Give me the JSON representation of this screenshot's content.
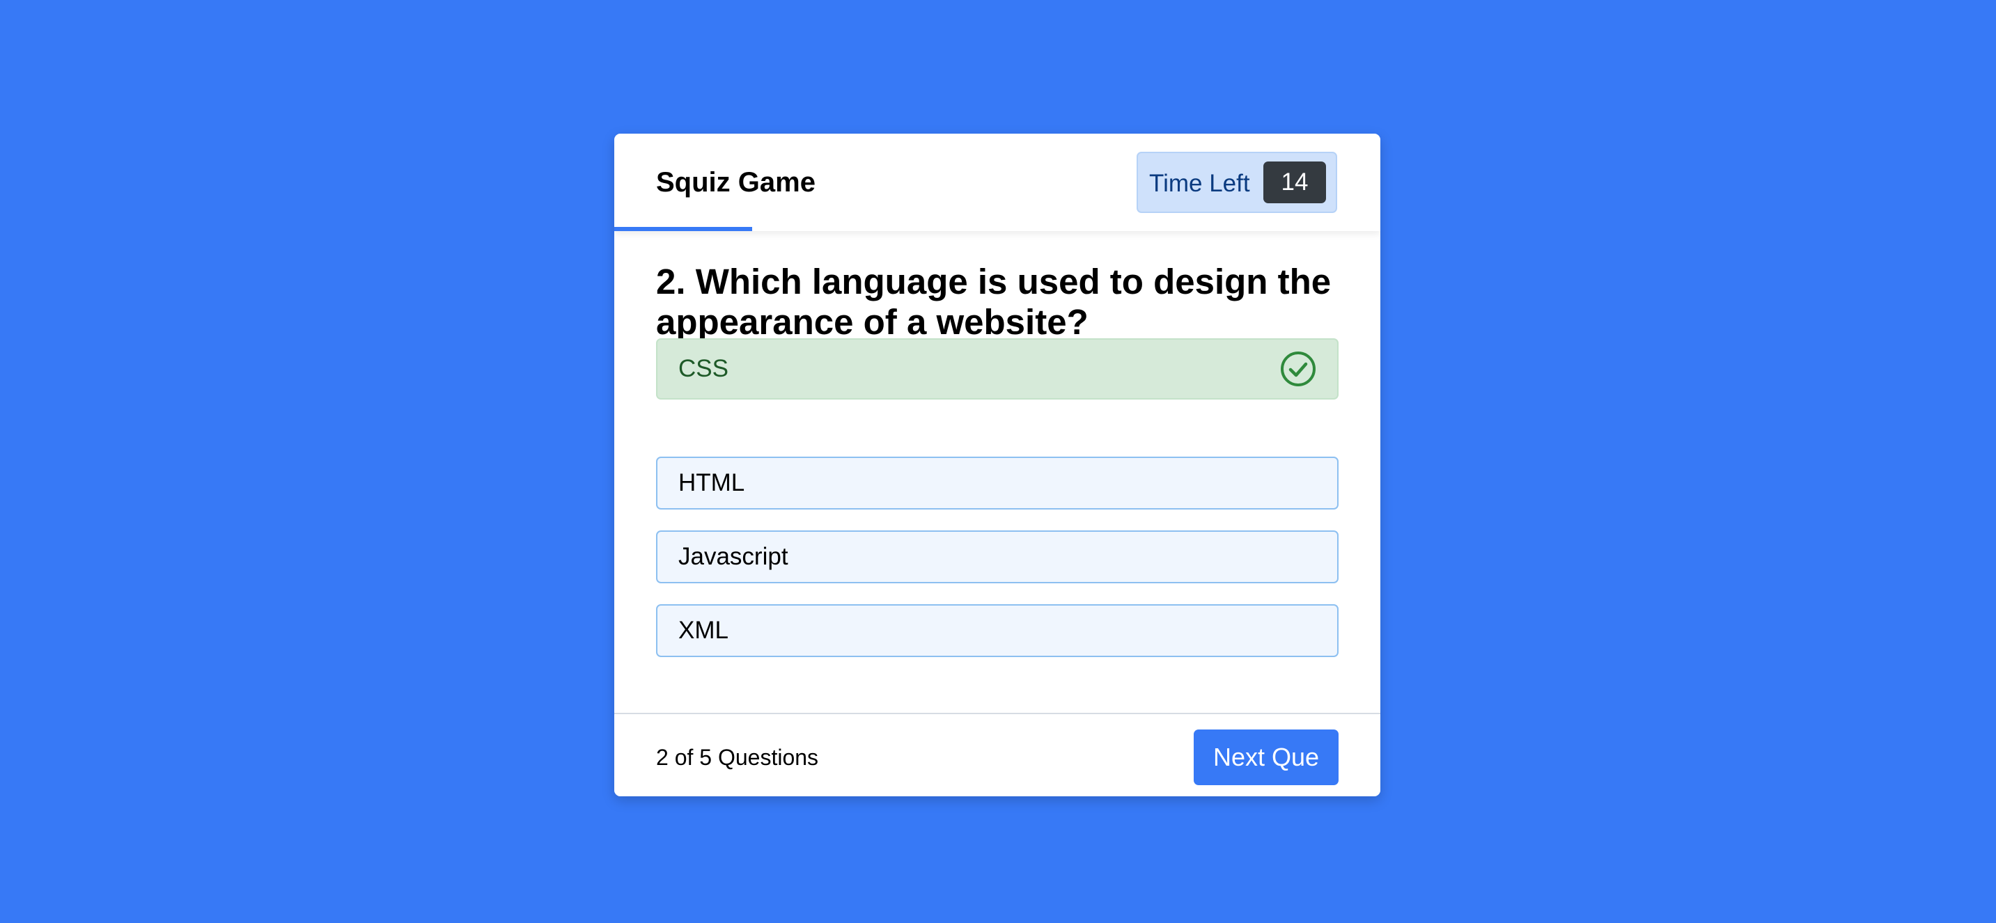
{
  "header": {
    "title": "Squiz Game",
    "timer_label": "Time Left",
    "timer_value": "14",
    "time_progress": 0.18
  },
  "question": {
    "text": "2. Which language is used to design the appearance of a website?"
  },
  "options": [
    {
      "label": "CSS",
      "state": "correct",
      "icon": "check-circle-icon"
    },
    {
      "label": "HTML",
      "state": "default"
    },
    {
      "label": "Javascript",
      "state": "default"
    },
    {
      "label": "XML",
      "state": "default"
    }
  ],
  "footer": {
    "progress_text": "2 of 5 Questions",
    "next_label": "Next Que"
  },
  "colors": {
    "background": "#3779f6",
    "accent": "#3779f6",
    "correct_bg": "#d6ead9",
    "correct_icon": "#2f8a3c",
    "option_bg": "#f0f6fe",
    "option_border": "#8dc0f1",
    "timer_bg": "#cfe1fb",
    "timer_value_bg": "#343a40"
  }
}
